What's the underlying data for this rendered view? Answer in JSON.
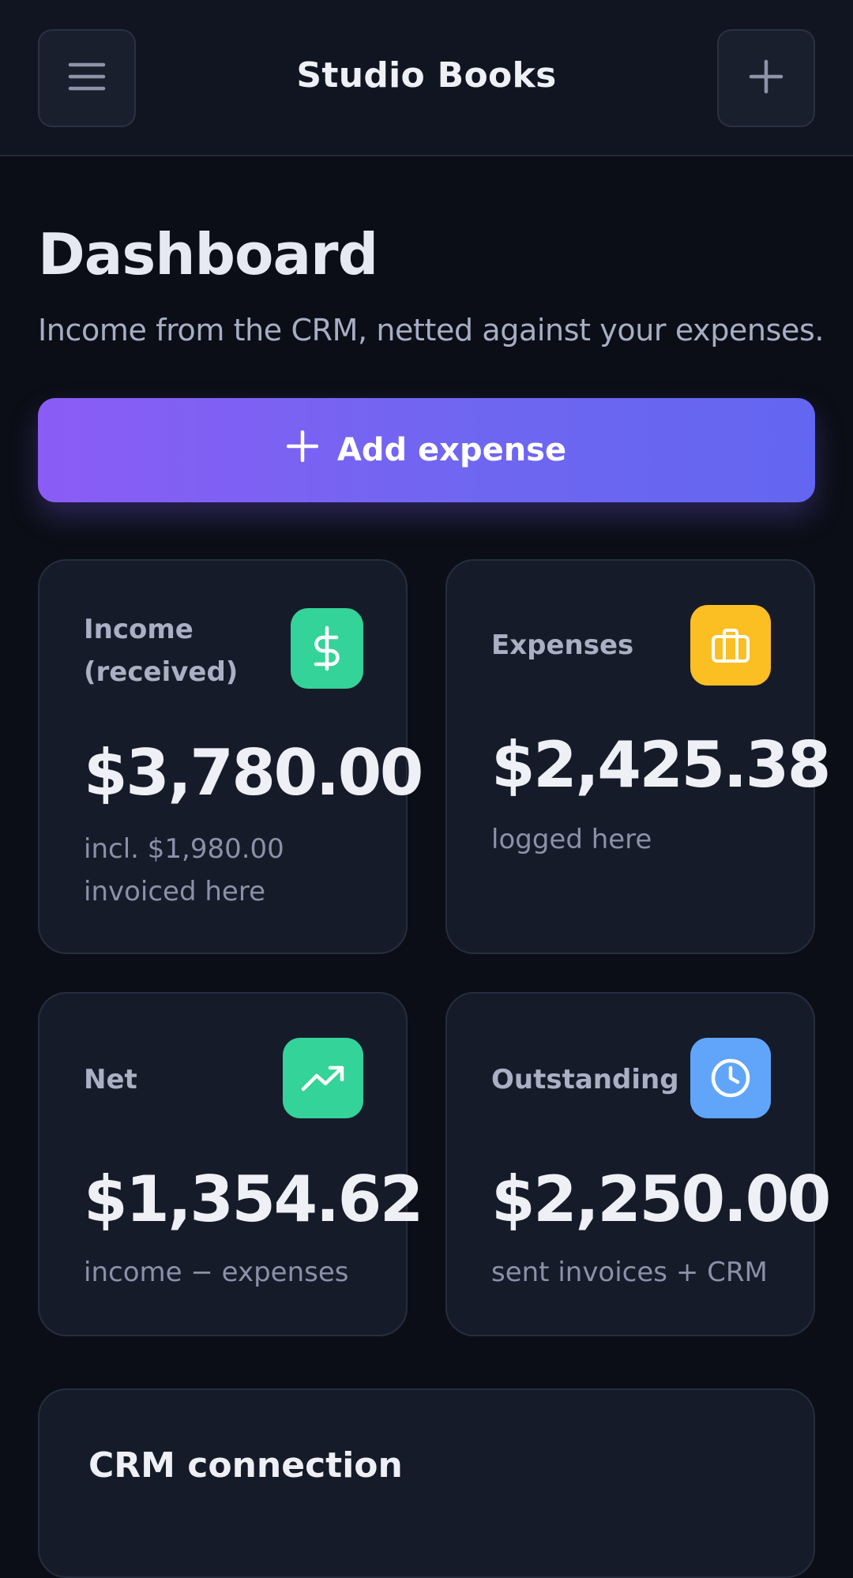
{
  "header": {
    "title": "Studio Books",
    "menu_icon": "hamburger-menu-icon",
    "add_icon": "plus-icon"
  },
  "page": {
    "title": "Dashboard",
    "subtitle": "Income from the CRM, netted against your expenses."
  },
  "add_expense": {
    "label": "Add expense",
    "icon": "plus-icon"
  },
  "stats": {
    "income": {
      "label": "Income (received)",
      "value": "$3,780.00",
      "note": "incl. $1,980.00 invoiced here",
      "icon": "dollar-icon",
      "color": "#34d399"
    },
    "expenses": {
      "label": "Expenses",
      "value": "$2,425.38",
      "note": "logged here",
      "icon": "briefcase-icon",
      "color": "#fbbf24"
    },
    "net": {
      "label": "Net",
      "value": "$1,354.62",
      "note": "income − expenses",
      "icon": "trending-up-icon",
      "color": "#34d399"
    },
    "outstanding": {
      "label": "Outstanding",
      "value": "$2,250.00",
      "note": "sent invoices + CRM",
      "icon": "clock-icon",
      "color": "#60a5fa"
    }
  },
  "crm": {
    "title": "CRM connection"
  },
  "colors": {
    "background": "#0b0e16",
    "card": "#161b29",
    "accent_start": "#8b5cf6",
    "accent_end": "#6366f1"
  }
}
